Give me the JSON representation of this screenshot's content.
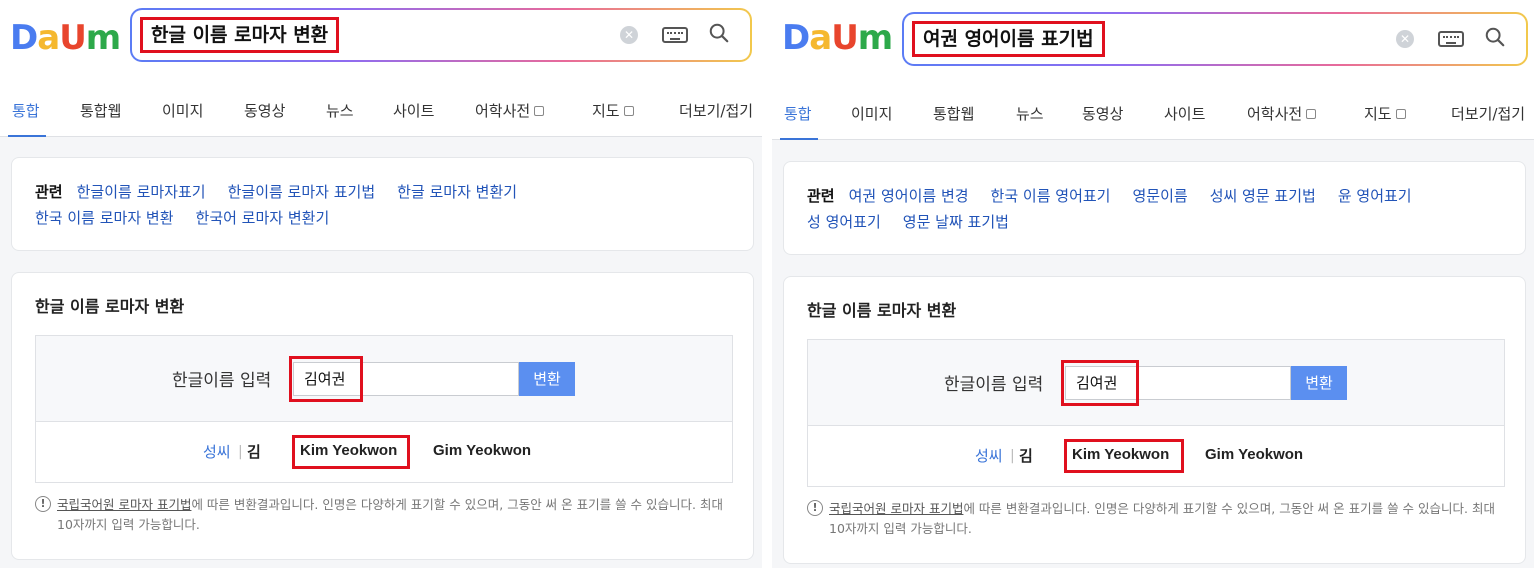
{
  "brand": {
    "logo_letters": [
      "D",
      "a",
      "U",
      "m"
    ],
    "logo_colors": [
      "#4a7cf0",
      "#f5b82e",
      "#e8452d",
      "#2da94a"
    ]
  },
  "colors": {
    "accent": "#3a74d8",
    "highlight_red": "#e0101e",
    "convert_button": "#5b8ff0",
    "link": "#2254b8"
  },
  "left": {
    "search": {
      "query": "한글 이름 로마자 변환"
    },
    "tabs": [
      {
        "label": "통합"
      },
      {
        "label": "통합웹"
      },
      {
        "label": "이미지"
      },
      {
        "label": "동영상"
      },
      {
        "label": "뉴스"
      },
      {
        "label": "사이트"
      },
      {
        "label": "어학사전"
      },
      {
        "label": "지도"
      },
      {
        "label": "더보기/접기"
      }
    ],
    "related": {
      "title": "관련",
      "links": [
        "한글이름 로마자표기",
        "한글이름 로마자 표기법",
        "한글 로마자 변환기",
        "한국 이름 로마자 변환",
        "한국어 로마자 변환기"
      ]
    },
    "converter": {
      "title": "한글 이름 로마자 변환",
      "input_label": "한글이름 입력",
      "input_value": "김여권",
      "convert_label": "변환",
      "surname_label": "성씨",
      "surname_separator": "|",
      "surname_value": "김",
      "results": [
        "Kim Yeokwon",
        "Gim Yeokwon"
      ],
      "note_icon": "!",
      "note_link": "국립국어원 로마자 표기법",
      "note_text": "에 따른 변환결과입니다. 인명은 다양하게 표기할 수 있으며, 그동안 써 온 표기를 쓸 수 있습니다. 최대 10자까지 입력 가능합니다."
    }
  },
  "right": {
    "search": {
      "query": "여권 영어이름 표기법"
    },
    "tabs": [
      {
        "label": "통합"
      },
      {
        "label": "이미지"
      },
      {
        "label": "통합웹"
      },
      {
        "label": "뉴스"
      },
      {
        "label": "동영상"
      },
      {
        "label": "사이트"
      },
      {
        "label": "어학사전"
      },
      {
        "label": "지도"
      },
      {
        "label": "더보기/접기"
      }
    ],
    "related": {
      "title": "관련",
      "links": [
        "여권 영어이름 변경",
        "한국 이름 영어표기",
        "영문이름",
        "성씨 영문 표기법",
        "윤 영어표기",
        "성 영어표기",
        "영문 날짜 표기법"
      ]
    },
    "converter": {
      "title": "한글 이름 로마자 변환",
      "input_label": "한글이름 입력",
      "input_value": "김여권",
      "convert_label": "변환",
      "surname_label": "성씨",
      "surname_separator": "|",
      "surname_value": "김",
      "results": [
        "Kim Yeokwon",
        "Gim Yeokwon"
      ],
      "note_icon": "!",
      "note_link": "국립국어원 로마자 표기법",
      "note_text": "에 따른 변환결과입니다. 인명은 다양하게 표기할 수 있으며, 그동안 써 온 표기를 쓸 수 있습니다. 최대 10자까지 입력 가능합니다."
    }
  }
}
